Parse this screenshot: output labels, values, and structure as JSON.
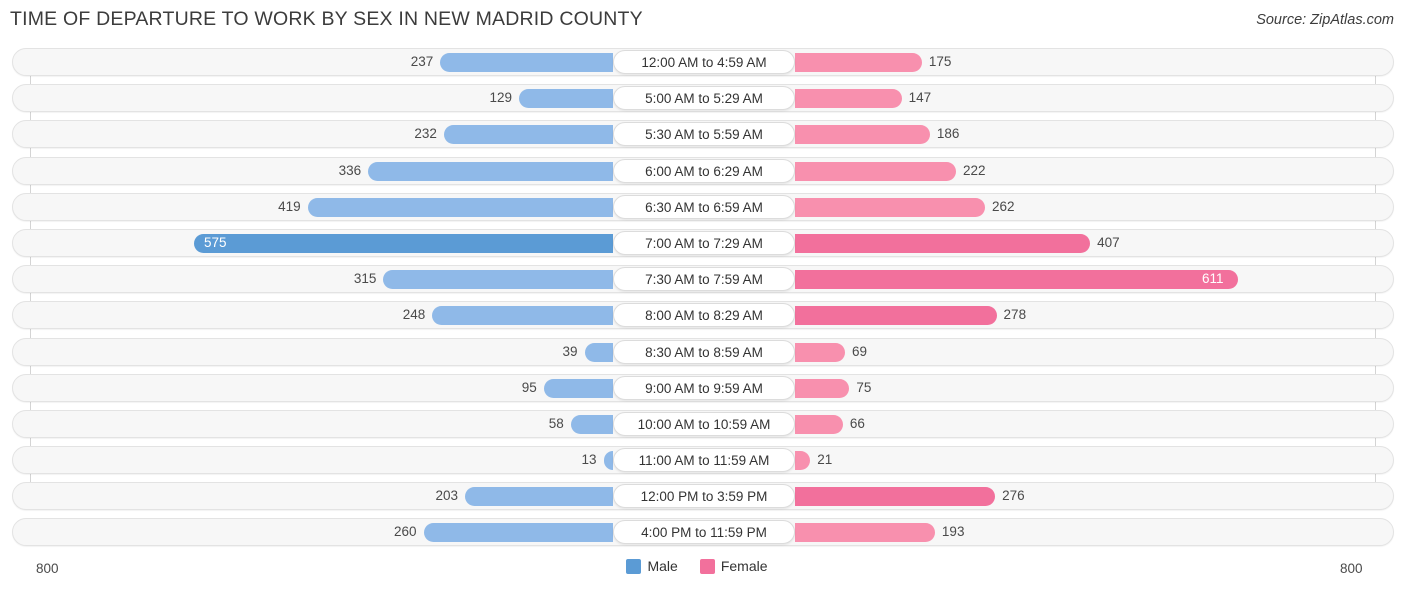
{
  "header": {
    "title": "TIME OF DEPARTURE TO WORK BY SEX IN NEW MADRID COUNTY",
    "source": "Source: ZipAtlas.com"
  },
  "legend": {
    "male_label": "Male",
    "female_label": "Female",
    "male_color": "#5b9bd5",
    "female_color": "#f2709c"
  },
  "axis": {
    "left_max": "800",
    "right_max": "800"
  },
  "chart_data": {
    "type": "bar",
    "orientation": "horizontal-diverging",
    "title": "TIME OF DEPARTURE TO WORK BY SEX IN NEW MADRID COUNTY",
    "xlabel": "",
    "ylabel": "",
    "xlim": [
      800,
      800
    ],
    "grid": true,
    "legend_position": "bottom-center",
    "categories": [
      "12:00 AM to 4:59 AM",
      "5:00 AM to 5:29 AM",
      "5:30 AM to 5:59 AM",
      "6:00 AM to 6:29 AM",
      "6:30 AM to 6:59 AM",
      "7:00 AM to 7:29 AM",
      "7:30 AM to 7:59 AM",
      "8:00 AM to 8:29 AM",
      "8:30 AM to 8:59 AM",
      "9:00 AM to 9:59 AM",
      "10:00 AM to 10:59 AM",
      "11:00 AM to 11:59 AM",
      "12:00 PM to 3:59 PM",
      "4:00 PM to 11:59 PM"
    ],
    "series": [
      {
        "name": "Male",
        "values": [
          237,
          129,
          232,
          336,
          419,
          575,
          315,
          248,
          39,
          95,
          58,
          13,
          203,
          260
        ]
      },
      {
        "name": "Female",
        "values": [
          175,
          147,
          186,
          222,
          262,
          407,
          611,
          278,
          69,
          75,
          66,
          21,
          276,
          193
        ]
      }
    ]
  },
  "rows": [
    {
      "label": "12:00 AM to 4:59 AM",
      "male": "237",
      "female": "175",
      "male_hi": false,
      "female_hi": false
    },
    {
      "label": "5:00 AM to 5:29 AM",
      "male": "129",
      "female": "147",
      "male_hi": false,
      "female_hi": false
    },
    {
      "label": "5:30 AM to 5:59 AM",
      "male": "232",
      "female": "186",
      "male_hi": false,
      "female_hi": false
    },
    {
      "label": "6:00 AM to 6:29 AM",
      "male": "336",
      "female": "222",
      "male_hi": false,
      "female_hi": false
    },
    {
      "label": "6:30 AM to 6:59 AM",
      "male": "419",
      "female": "262",
      "male_hi": false,
      "female_hi": false
    },
    {
      "label": "7:00 AM to 7:29 AM",
      "male": "575",
      "female": "407",
      "male_hi": true,
      "female_hi": true
    },
    {
      "label": "7:30 AM to 7:59 AM",
      "male": "315",
      "female": "611",
      "male_hi": false,
      "female_hi": true
    },
    {
      "label": "8:00 AM to 8:29 AM",
      "male": "248",
      "female": "278",
      "male_hi": false,
      "female_hi": true
    },
    {
      "label": "8:30 AM to 8:59 AM",
      "male": "39",
      "female": "69",
      "male_hi": false,
      "female_hi": false
    },
    {
      "label": "9:00 AM to 9:59 AM",
      "male": "95",
      "female": "75",
      "male_hi": false,
      "female_hi": false
    },
    {
      "label": "10:00 AM to 10:59 AM",
      "male": "58",
      "female": "66",
      "male_hi": false,
      "female_hi": false
    },
    {
      "label": "11:00 AM to 11:59 AM",
      "male": "13",
      "female": "21",
      "male_hi": false,
      "female_hi": false
    },
    {
      "label": "12:00 PM to 3:59 PM",
      "male": "203",
      "female": "276",
      "male_hi": false,
      "female_hi": true
    },
    {
      "label": "4:00 PM to 11:59 PM",
      "male": "260",
      "female": "193",
      "male_hi": false,
      "female_hi": false
    }
  ]
}
